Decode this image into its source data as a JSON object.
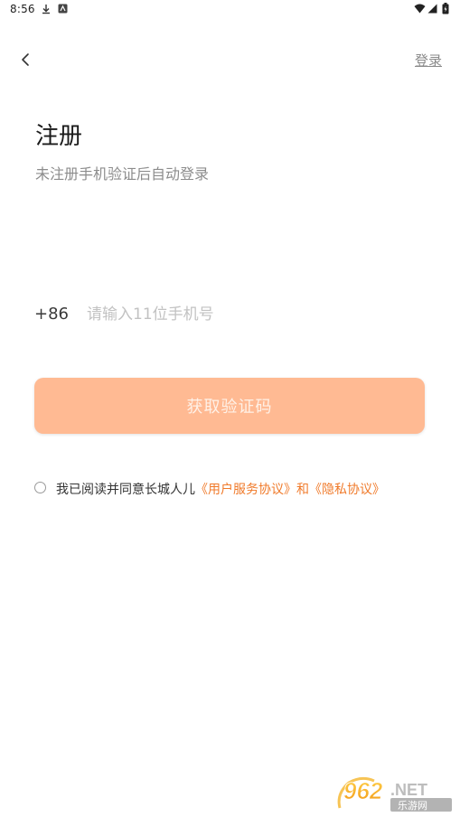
{
  "status_bar": {
    "time": "8:56",
    "icons": [
      "download-icon",
      "app-notification-icon",
      "wifi-icon",
      "signal-icon",
      "battery-icon"
    ]
  },
  "nav": {
    "back_icon": "chevron-left-icon",
    "login_label": "登录"
  },
  "header": {
    "title": "注册",
    "subtitle": "未注册手机验证后自动登录"
  },
  "form": {
    "country_code": "+86",
    "phone_placeholder": "请输入11位手机号",
    "phone_value": "",
    "get_code_label": "获取验证码"
  },
  "agreement": {
    "prefix": "我已阅读并同意长城人儿",
    "user_agreement": "《用户服务协议》",
    "and": "和",
    "privacy_policy": "《隐私协议》",
    "checked": false
  },
  "watermark": {
    "number": "962",
    "suffix": ".NET",
    "site_name": "乐游网"
  },
  "colors": {
    "accent": "#ffba93",
    "link": "#f07a2a",
    "muted": "#8c8c8c",
    "placeholder": "#c2c2c2"
  }
}
